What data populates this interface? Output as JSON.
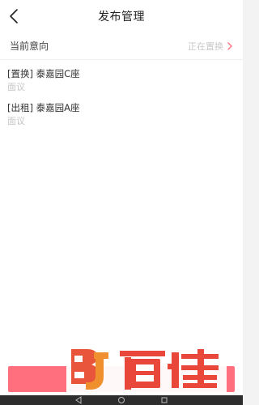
{
  "header": {
    "title": "发布管理",
    "back_icon": "chevron-left-icon"
  },
  "intent": {
    "label": "当前意向",
    "value": "正在置换",
    "chevron_icon": "chevron-right-icon"
  },
  "listings": [
    {
      "title": "[置换] 泰嘉园C座",
      "price": "面议"
    },
    {
      "title": "[出租] 泰嘉园A座",
      "price": "面议"
    }
  ],
  "colors": {
    "accent": "#ff6f7e",
    "muted_text": "#c5c5c5"
  },
  "watermark": {
    "text": "BJ百佳"
  },
  "system_nav": {
    "icons": [
      "back-triangle-icon",
      "home-circle-icon",
      "recents-square-icon"
    ]
  }
}
